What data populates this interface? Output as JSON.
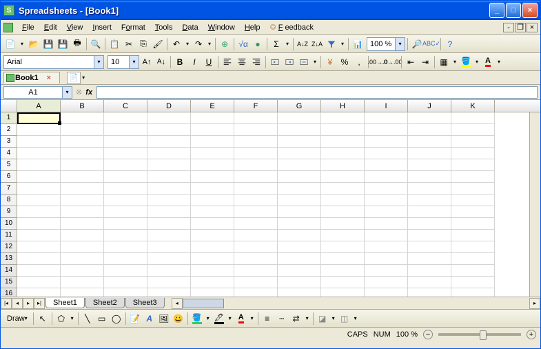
{
  "window": {
    "title": "Spreadsheets - [Book1]"
  },
  "menu": {
    "file": "File",
    "edit": "Edit",
    "view": "View",
    "insert": "Insert",
    "format": "Format",
    "tools": "Tools",
    "data": "Data",
    "window": "Window",
    "help": "Help",
    "feedback": "Feedback"
  },
  "toolbar1": {
    "zoom": "100 %"
  },
  "toolbar2": {
    "font": "Arial",
    "size": "10"
  },
  "document": {
    "tab_name": "Book1"
  },
  "namebox": {
    "cell": "A1"
  },
  "grid": {
    "columns": [
      "A",
      "B",
      "C",
      "D",
      "E",
      "F",
      "G",
      "H",
      "I",
      "J",
      "K"
    ],
    "rows": [
      1,
      2,
      3,
      4,
      5,
      6,
      7,
      8,
      9,
      10,
      11,
      12,
      13,
      14,
      15,
      16
    ],
    "active_col": "A",
    "active_row": 1
  },
  "sheets": {
    "tabs": [
      "Sheet1",
      "Sheet2",
      "Sheet3"
    ],
    "active": 0
  },
  "drawbar": {
    "label": "Draw"
  },
  "status": {
    "caps": "CAPS",
    "num": "NUM",
    "zoom": "100 %"
  }
}
